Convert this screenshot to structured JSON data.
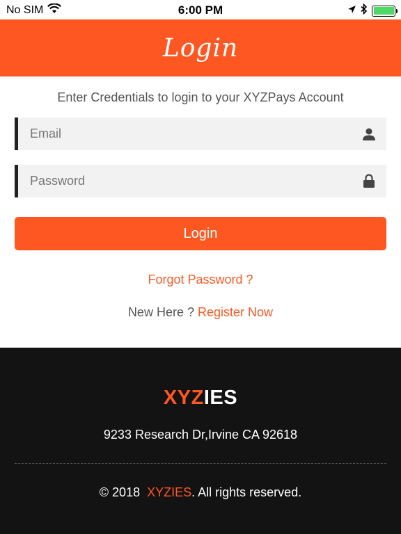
{
  "status_bar": {
    "carrier": "No SIM",
    "time": "6:00 PM"
  },
  "header": {
    "title": "Login"
  },
  "main": {
    "subtitle": "Enter Credentials to login to your XYZPays Account",
    "email_placeholder": "Email",
    "password_placeholder": "Password",
    "login_label": "Login",
    "forgot_label": "Forgot Password ?",
    "new_here_label": "New Here ?",
    "register_label": "Register Now"
  },
  "footer": {
    "brand_accent": "XYZ",
    "brand_rest": "IES",
    "address": "9233 Research Dr,Irvine CA 92618",
    "copyright_prefix": "© 2018",
    "copyright_brand": "XYZIES",
    "copyright_suffix": ". All rights reserved."
  },
  "colors": {
    "accent": "#ff5722",
    "footer_bg": "#131313",
    "battery": "#4cd964"
  },
  "icons": {
    "wifi": "wifi-icon",
    "location": "location-arrow-icon",
    "bluetooth": "bluetooth-icon",
    "battery": "battery-icon",
    "user": "user-icon",
    "lock": "lock-icon"
  }
}
